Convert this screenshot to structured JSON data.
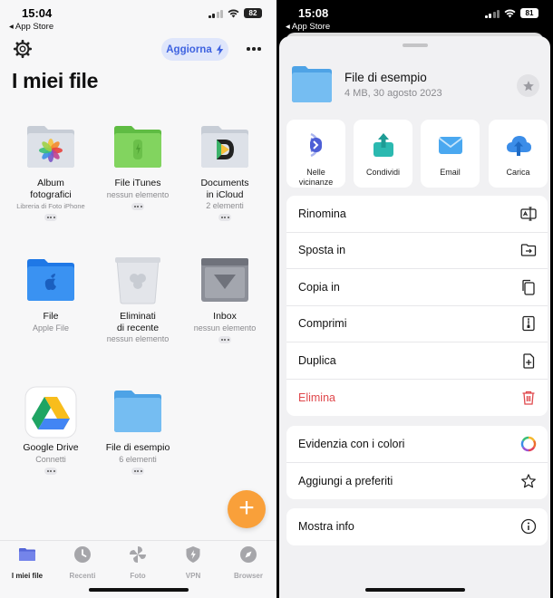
{
  "left": {
    "status": {
      "time": "15:04",
      "back": "◂ App Store",
      "battery": "82"
    },
    "update_label": "Aggiorna",
    "title": "I miei file",
    "tiles": [
      {
        "name": "Album\nfotografici",
        "sub": "Libreria di Foto iPhone"
      },
      {
        "name": "File iTunes",
        "sub": "nessun elemento"
      },
      {
        "name": "Documents\nin iCloud",
        "sub": "2 elementi"
      },
      {
        "name": "File",
        "sub": "Apple File"
      },
      {
        "name": "Eliminati\ndi recente",
        "sub": "nessun elemento"
      },
      {
        "name": "Inbox",
        "sub": "nessun elemento"
      },
      {
        "name": "Google Drive",
        "sub": "Connetti"
      },
      {
        "name": "File di esempio",
        "sub": "6 elementi"
      }
    ],
    "fab": "+",
    "tabs": [
      {
        "label": "I miei file"
      },
      {
        "label": "Recenti"
      },
      {
        "label": "Foto"
      },
      {
        "label": "VPN"
      },
      {
        "label": "Browser"
      }
    ]
  },
  "right": {
    "status": {
      "time": "15:08",
      "back": "◂ App Store",
      "battery": "81"
    },
    "file": {
      "title": "File di esempio",
      "sub": "4 MB, 30 agosto 2023"
    },
    "actions": [
      {
        "label": "Nelle\nvicinanze"
      },
      {
        "label": "Condividi"
      },
      {
        "label": "Email"
      },
      {
        "label": "Carica"
      }
    ],
    "group1": [
      {
        "label": "Rinomina"
      },
      {
        "label": "Sposta in"
      },
      {
        "label": "Copia in"
      },
      {
        "label": "Comprimi"
      },
      {
        "label": "Duplica"
      },
      {
        "label": "Elimina"
      }
    ],
    "group2": [
      {
        "label": "Evidenzia con i colori"
      },
      {
        "label": "Aggiungi a preferiti"
      }
    ],
    "group3": [
      {
        "label": "Mostra info"
      }
    ]
  },
  "colors": {
    "accent": "#3f63e0",
    "fab": "#f9a03a",
    "danger": "#e0484c",
    "folder_blue": "#6fb6ee",
    "folder_green": "#7fd35c"
  }
}
